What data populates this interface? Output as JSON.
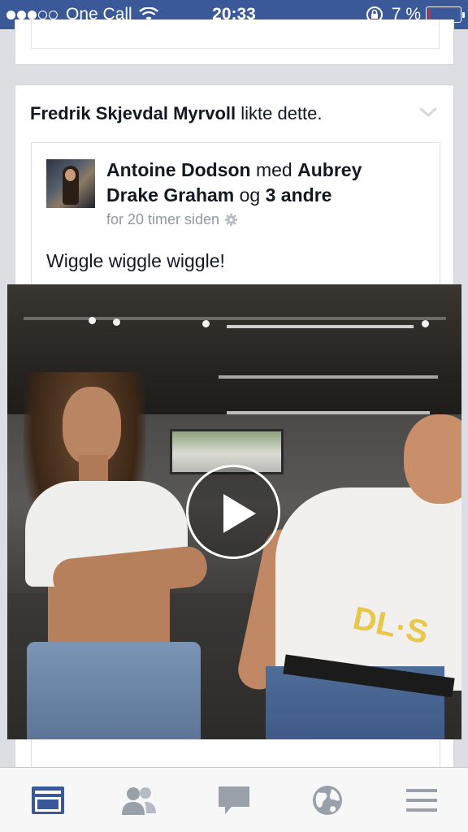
{
  "status_bar": {
    "carrier": "One Call",
    "time": "20:33",
    "battery_percent": "7 %",
    "battery_level": 0.07,
    "signal_bars_filled": 3,
    "signal_bars_total": 5
  },
  "feed": {
    "story_header": {
      "actor": "Fredrik Skjevdal Myrvoll",
      "action": "likte dette."
    },
    "post": {
      "author": "Antoine Dodson",
      "with_word": "med",
      "tagged_person": "Aubrey Drake Graham",
      "and_word": "og",
      "others": "3 andre",
      "timestamp": "for 20 timer siden",
      "text": "Wiggle wiggle wiggle!",
      "video_overlay_text": "DL·S"
    }
  },
  "tab_bar": {
    "items": [
      {
        "icon": "news-feed-icon",
        "active": true
      },
      {
        "icon": "friend-requests-icon",
        "active": false
      },
      {
        "icon": "messages-icon",
        "active": false
      },
      {
        "icon": "notifications-globe-icon",
        "active": false
      },
      {
        "icon": "menu-icon",
        "active": false
      }
    ]
  },
  "colors": {
    "brand_blue": "#3b5998",
    "active_tab": "#3b5998",
    "inactive_tab": "#9aa0aa",
    "battery_low": "#e0242c"
  }
}
